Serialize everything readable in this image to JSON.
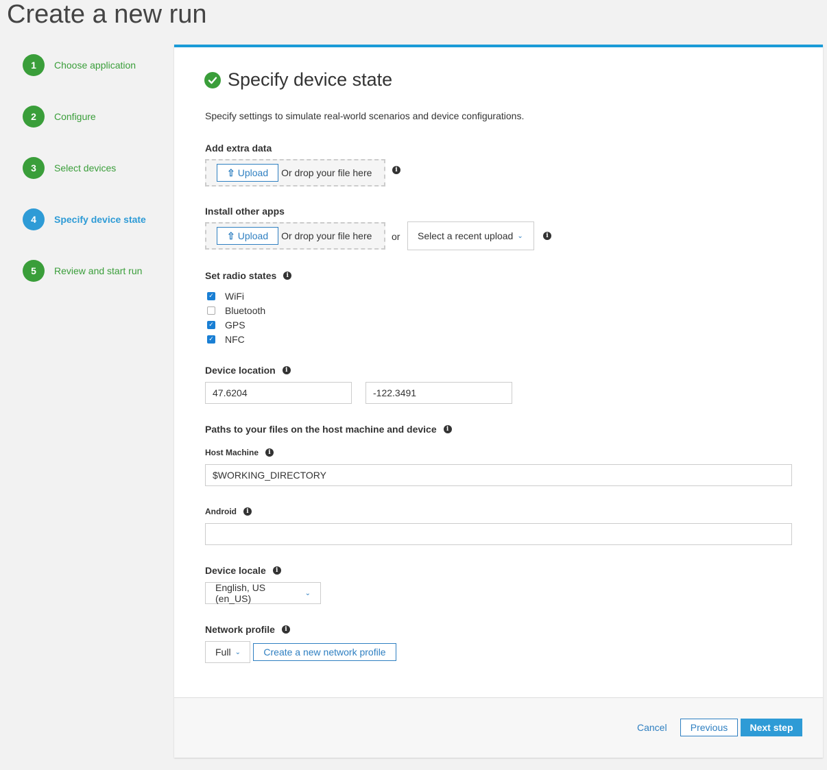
{
  "page": {
    "title": "Create a new run"
  },
  "steps": [
    {
      "num": "1",
      "label": "Choose application"
    },
    {
      "num": "2",
      "label": "Configure"
    },
    {
      "num": "3",
      "label": "Select devices"
    },
    {
      "num": "4",
      "label": "Specify device state"
    },
    {
      "num": "5",
      "label": "Review and start run"
    }
  ],
  "section": {
    "title": "Specify device state",
    "description": "Specify settings to simulate real-world scenarios and device configurations."
  },
  "extra_data": {
    "label": "Add extra data",
    "upload": "Upload",
    "drop": "Or drop your file here"
  },
  "other_apps": {
    "label": "Install other apps",
    "upload": "Upload",
    "drop": "Or drop your file here",
    "or": "or",
    "recent": "Select a recent upload"
  },
  "radio": {
    "label": "Set radio states",
    "items": [
      {
        "label": "WiFi",
        "checked": true
      },
      {
        "label": "Bluetooth",
        "checked": false
      },
      {
        "label": "GPS",
        "checked": true
      },
      {
        "label": "NFC",
        "checked": true
      }
    ]
  },
  "location": {
    "label": "Device location",
    "lat": "47.6204",
    "lon": "-122.3491"
  },
  "paths": {
    "label": "Paths to your files on the host machine and device",
    "host_label": "Host Machine",
    "host_value": "$WORKING_DIRECTORY",
    "android_label": "Android",
    "android_value": ""
  },
  "locale": {
    "label": "Device locale",
    "value": "English, US (en_US)"
  },
  "network": {
    "label": "Network profile",
    "value": "Full",
    "create": "Create a new network profile"
  },
  "footer": {
    "cancel": "Cancel",
    "previous": "Previous",
    "next": "Next step"
  },
  "colors": {
    "accent": "#2e9bd6",
    "success": "#3a9e3a",
    "panel_border": "#1a9bd7"
  }
}
